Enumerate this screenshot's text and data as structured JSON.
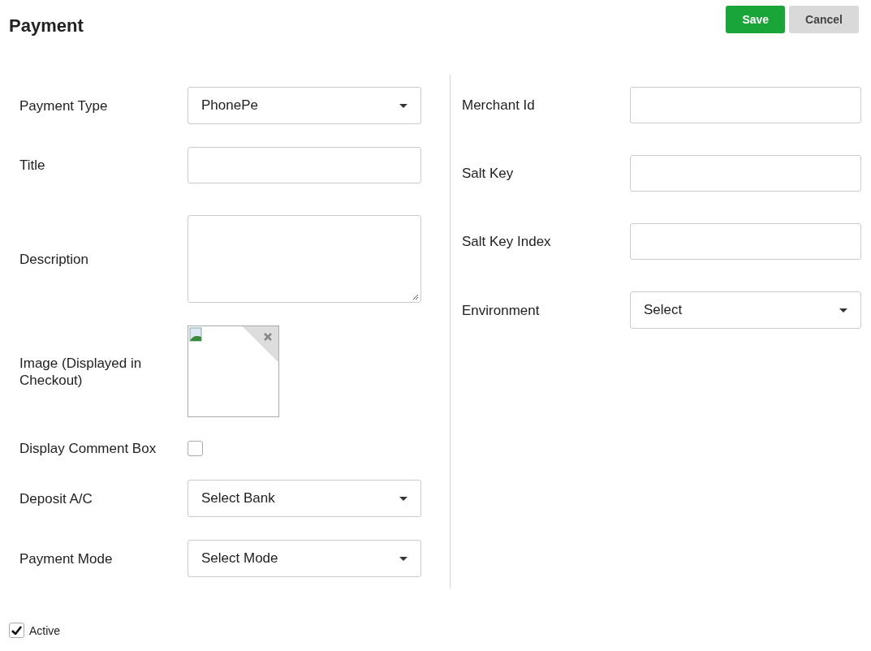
{
  "header": {
    "title": "Payment",
    "buttons": [
      {
        "label": "Save",
        "kind": "primary"
      },
      {
        "label": "Cancel",
        "kind": "secondary"
      }
    ]
  },
  "left_fields": [
    {
      "label": "Payment Type",
      "kind": "select",
      "value": "PhonePe"
    },
    {
      "label": "Title",
      "kind": "input"
    },
    {
      "label": "Description",
      "kind": "textarea"
    },
    {
      "label": "Image (Displayed in Checkout)",
      "kind": "image"
    },
    {
      "label": "Display Comment Box",
      "kind": "checkbox",
      "checked": false
    },
    {
      "label": "Deposit A/C",
      "kind": "select",
      "value": "Select Bank"
    },
    {
      "label": "Payment Mode",
      "kind": "select",
      "value": "Select Mode"
    }
  ],
  "right_fields": [
    {
      "label": "Merchant Id",
      "kind": "input"
    },
    {
      "label": "Salt Key",
      "kind": "input"
    },
    {
      "label": "Salt Key Index",
      "kind": "input"
    },
    {
      "label": "Environment",
      "kind": "select",
      "value": "Select"
    }
  ],
  "active": {
    "label": "Active",
    "checked": true
  }
}
